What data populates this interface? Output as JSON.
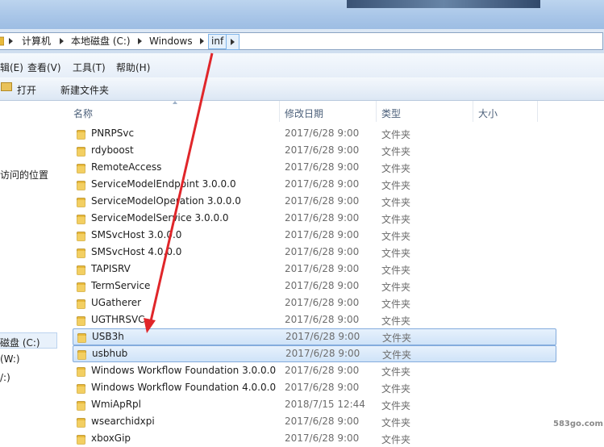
{
  "address": {
    "crumbs": [
      "计算机",
      "本地磁盘 (C:)",
      "Windows",
      "inf"
    ]
  },
  "menu": {
    "items": [
      "编辑(E)",
      "查看(V)",
      "工具(T)",
      "帮助(H)"
    ],
    "shown": [
      "辑(E)",
      "查看(V)",
      "工具(T)",
      "帮助(H)"
    ]
  },
  "commands": {
    "open": "打开",
    "new_folder": "新建文件夹"
  },
  "nav": {
    "items": [
      "访问的位置",
      "磁盘 (C:)",
      "(W:)",
      "/:)"
    ]
  },
  "columns": {
    "name": "名称",
    "date": "修改日期",
    "type": "类型",
    "size": "大小"
  },
  "files": [
    {
      "name": "PNRPSvc",
      "date": "2017/6/28 9:00",
      "type": "文件夹",
      "selected": false
    },
    {
      "name": "rdyboost",
      "date": "2017/6/28 9:00",
      "type": "文件夹",
      "selected": false
    },
    {
      "name": "RemoteAccess",
      "date": "2017/6/28 9:00",
      "type": "文件夹",
      "selected": false
    },
    {
      "name": "ServiceModelEndpoint 3.0.0.0",
      "date": "2017/6/28 9:00",
      "type": "文件夹",
      "selected": false
    },
    {
      "name": "ServiceModelOperation 3.0.0.0",
      "date": "2017/6/28 9:00",
      "type": "文件夹",
      "selected": false
    },
    {
      "name": "ServiceModelService 3.0.0.0",
      "date": "2017/6/28 9:00",
      "type": "文件夹",
      "selected": false
    },
    {
      "name": "SMSvcHost 3.0.0.0",
      "date": "2017/6/28 9:00",
      "type": "文件夹",
      "selected": false
    },
    {
      "name": "SMSvcHost 4.0.0.0",
      "date": "2017/6/28 9:00",
      "type": "文件夹",
      "selected": false
    },
    {
      "name": "TAPISRV",
      "date": "2017/6/28 9:00",
      "type": "文件夹",
      "selected": false
    },
    {
      "name": "TermService",
      "date": "2017/6/28 9:00",
      "type": "文件夹",
      "selected": false
    },
    {
      "name": "UGatherer",
      "date": "2017/6/28 9:00",
      "type": "文件夹",
      "selected": false
    },
    {
      "name": "UGTHRSVC",
      "date": "2017/6/28 9:00",
      "type": "文件夹",
      "selected": false
    },
    {
      "name": "USB3h",
      "date": "2017/6/28 9:00",
      "type": "文件夹",
      "selected": true
    },
    {
      "name": "usbhub",
      "date": "2017/6/28 9:00",
      "type": "文件夹",
      "selected": true
    },
    {
      "name": "Windows Workflow Foundation 3.0.0.0",
      "date": "2017/6/28 9:00",
      "type": "文件夹",
      "selected": false
    },
    {
      "name": "Windows Workflow Foundation 4.0.0.0",
      "date": "2017/6/28 9:00",
      "type": "文件夹",
      "selected": false
    },
    {
      "name": "WmiApRpl",
      "date": "2018/7/15 12:44",
      "type": "文件夹",
      "selected": false
    },
    {
      "name": "wsearchidxpi",
      "date": "2017/6/28 9:00",
      "type": "文件夹",
      "selected": false
    },
    {
      "name": "xboxGip",
      "date": "2017/6/28 9:00",
      "type": "文件夹",
      "selected": false
    }
  ],
  "watermark": "583go.com",
  "colors": {
    "folder": "#e8b93a",
    "selection": "#cfe3f8",
    "annotation_arrow": "#e0262a"
  }
}
